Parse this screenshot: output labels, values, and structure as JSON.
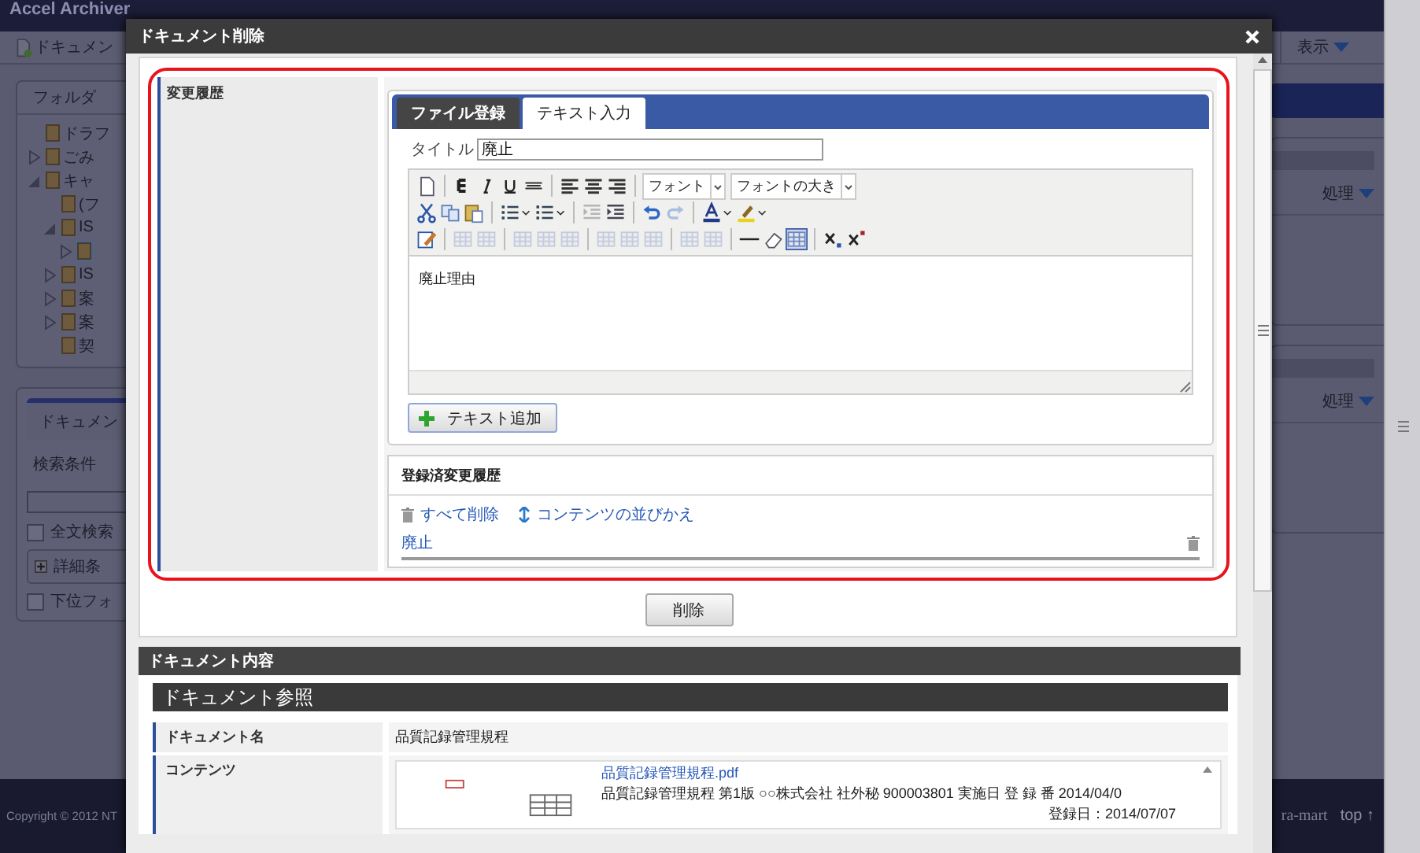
{
  "app": {
    "title": "Accel Archiver",
    "new_button": "ドキュメン",
    "view_menu": "表示"
  },
  "folder_panel": {
    "title": "フォルダ",
    "tree": [
      {
        "label": "ドラフ",
        "selected": false
      },
      {
        "label": "ごみ",
        "selected": false,
        "expanded": false
      },
      {
        "label": "キャ",
        "selected": false,
        "expanded": true,
        "children": [
          {
            "label": "(フ",
            "selected": false
          },
          {
            "label": "IS",
            "selected": false,
            "expanded": true,
            "children": [
              {
                "selected": true,
                "expanded": false
              }
            ]
          },
          {
            "label": "IS",
            "selected": false,
            "expanded": false
          },
          {
            "label": "案",
            "selected": false,
            "expanded": false
          },
          {
            "label": "案",
            "selected": false,
            "expanded": false
          },
          {
            "label": "契",
            "selected": false
          }
        ]
      }
    ]
  },
  "search_panel": {
    "tab": "ドキュメン",
    "section": "検索条件",
    "fulltext": {
      "label": "全文検索",
      "checked": false
    },
    "detail_button": "詳細条",
    "subfolder": {
      "label": "下位フォ",
      "checked": false
    }
  },
  "right_panels": [
    {
      "action": "処理"
    },
    {
      "action": "処理"
    }
  ],
  "footer": {
    "copyright": "Copyright © 2012 NT",
    "brand": "ra-mart",
    "top_link": "top ↑"
  },
  "dialog": {
    "title": "ドキュメント削除",
    "history_label": "変更履歴",
    "tabs": [
      {
        "label": "ファイル登録",
        "selected": false
      },
      {
        "label": "テキスト入力",
        "selected": true
      }
    ],
    "title_field": {
      "label": "タイトル",
      "value": "廃止"
    },
    "editor": {
      "body": "廃止理由",
      "toolbar": [
        [
          {
            "kind": "button",
            "disabled": false,
            "pressed": false
          },
          {
            "kind": "separator"
          },
          {
            "kind": "button",
            "disabled": false,
            "pressed": false
          },
          {
            "kind": "button",
            "disabled": false,
            "pressed": false
          },
          {
            "kind": "button",
            "disabled": false,
            "pressed": false
          },
          {
            "kind": "button",
            "disabled": false,
            "pressed": false
          },
          {
            "kind": "separator"
          },
          {
            "kind": "button",
            "disabled": false,
            "pressed": false
          },
          {
            "kind": "button",
            "disabled": false,
            "pressed": false
          },
          {
            "kind": "button",
            "disabled": false,
            "pressed": false
          },
          {
            "kind": "separator"
          },
          {
            "kind": "select",
            "value": "フォント"
          },
          {
            "kind": "select",
            "value": "フォントの大き"
          }
        ],
        [
          {
            "kind": "button",
            "disabled": false,
            "pressed": false
          },
          {
            "kind": "button",
            "disabled": false,
            "pressed": false
          },
          {
            "kind": "button",
            "disabled": false,
            "pressed": false
          },
          {
            "kind": "separator"
          },
          {
            "kind": "menu",
            "disabled": false,
            "pressed": false
          },
          {
            "kind": "menu",
            "disabled": false,
            "pressed": false
          },
          {
            "kind": "separator"
          },
          {
            "kind": "button",
            "disabled": true,
            "pressed": false
          },
          {
            "kind": "button",
            "disabled": false,
            "pressed": false
          },
          {
            "kind": "separator"
          },
          {
            "kind": "button",
            "disabled": false,
            "pressed": false
          },
          {
            "kind": "button",
            "disabled": true,
            "pressed": false
          },
          {
            "kind": "separator"
          },
          {
            "kind": "menu",
            "disabled": false,
            "pressed": false
          },
          {
            "kind": "menu",
            "disabled": false,
            "pressed": false
          }
        ],
        [
          {
            "kind": "button",
            "disabled": false,
            "pressed": false
          },
          {
            "kind": "separator"
          },
          {
            "kind": "button",
            "disabled": true,
            "pressed": false
          },
          {
            "kind": "button",
            "disabled": true,
            "pressed": false
          },
          {
            "kind": "separator"
          },
          {
            "kind": "button",
            "disabled": true,
            "pressed": false
          },
          {
            "kind": "button",
            "disabled": true,
            "pressed": false
          },
          {
            "kind": "button",
            "disabled": true,
            "pressed": false
          },
          {
            "kind": "separator"
          },
          {
            "kind": "button",
            "disabled": true,
            "pressed": false
          },
          {
            "kind": "button",
            "disabled": true,
            "pressed": false
          },
          {
            "kind": "button",
            "disabled": true,
            "pressed": false
          },
          {
            "kind": "separator"
          },
          {
            "kind": "button",
            "disabled": true,
            "pressed": false
          },
          {
            "kind": "button",
            "disabled": true,
            "pressed": false
          },
          {
            "kind": "separator"
          },
          {
            "kind": "button",
            "disabled": false,
            "pressed": false
          },
          {
            "kind": "button",
            "disabled": false,
            "pressed": false
          },
          {
            "kind": "button",
            "disabled": false,
            "pressed": true
          },
          {
            "kind": "separator"
          },
          {
            "kind": "button",
            "disabled": false,
            "pressed": false
          },
          {
            "kind": "button",
            "disabled": false,
            "pressed": false
          }
        ]
      ]
    },
    "add_text_button": "テキスト追加",
    "history_panel": {
      "title": "登録済変更履歴",
      "actions": [
        {
          "kind": "delete-all",
          "label": "すべて削除"
        },
        {
          "kind": "reorder",
          "label": "コンテンツの並びかえ"
        }
      ],
      "entries": [
        {
          "label": "廃止"
        }
      ]
    },
    "delete_button": "削除",
    "content_section": {
      "title": "ドキュメント内容",
      "subtitle": "ドキュメント参照",
      "fields": [
        {
          "kind": "text",
          "label": "ドキュメント名",
          "value": "品質記録管理規程"
        },
        {
          "kind": "file",
          "label": "コンテンツ",
          "file_name": "品質記録管理規程.pdf",
          "summary": "品質記録管理規程 第1版 ○○株式会社 社外秘 900003801 実施日 登 録 番 2014/04/0",
          "registered": "登録日：2014/07/07"
        }
      ]
    }
  }
}
